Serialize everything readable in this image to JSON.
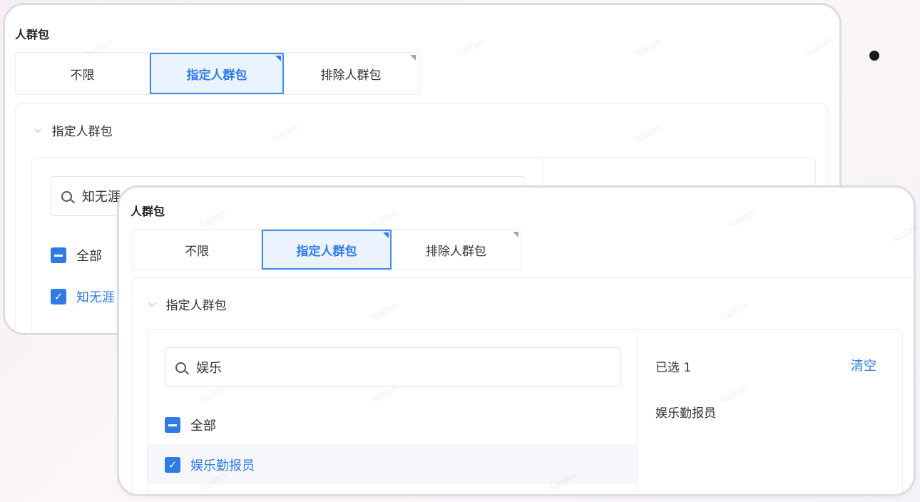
{
  "back_card": {
    "section_title": "人群包",
    "tabs": [
      {
        "label": "不限",
        "active": false
      },
      {
        "label": "指定人群包",
        "active": true
      },
      {
        "label": "排除人群包",
        "active": false
      }
    ],
    "collapse_title": "指定人群包",
    "search_value": "知无涯",
    "all_label": "全部",
    "item_label": "知无涯"
  },
  "front_card": {
    "section_title": "人群包",
    "tabs": [
      {
        "label": "不限",
        "active": false
      },
      {
        "label": "指定人群包",
        "active": true
      },
      {
        "label": "排除人群包",
        "active": false
      }
    ],
    "collapse_title": "指定人群包",
    "search_value": "娱乐",
    "all_label": "全部",
    "item_label": "娱乐勤报员",
    "selected_count_label": "已选 1",
    "clear_label": "清空",
    "selected_items": [
      "娱乐勤报员"
    ]
  },
  "watermark": "luolan",
  "colors": {
    "accent": "#2f7ae5",
    "tab_active_bg": "#eaf3ff"
  },
  "icons": {
    "search": "search-icon",
    "chevron": "chevron-down-icon",
    "check": "checkbox-checked-icon",
    "indeterminate": "checkbox-indeterminate-icon"
  }
}
